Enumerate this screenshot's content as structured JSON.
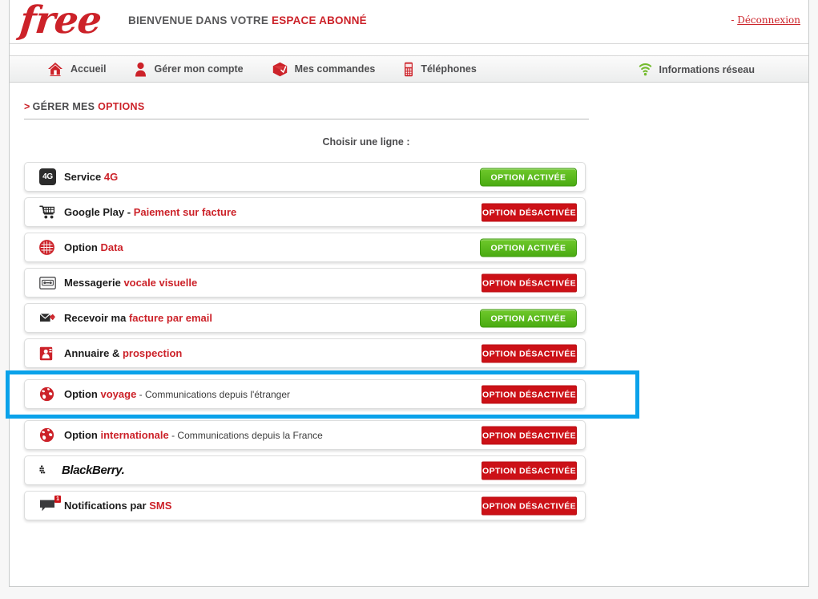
{
  "header": {
    "logo": "free",
    "welcome_prefix": "BIENVENUE DANS VOTRE ",
    "welcome_highlight": "ESPACE ABONNÉ",
    "logout_dash": "- ",
    "logout_label": "Déconnexion"
  },
  "nav": {
    "items": [
      {
        "label": "Accueil",
        "icon": "home-icon"
      },
      {
        "label": "Gérer mon compte",
        "icon": "person-icon"
      },
      {
        "label": "Mes commandes",
        "icon": "package-icon"
      },
      {
        "label": "Téléphones",
        "icon": "mobile-phone-icon"
      }
    ],
    "right": {
      "label": "Informations réseau",
      "icon": "wifi-icon"
    }
  },
  "breadcrumb": {
    "arrow": ">",
    "prefix": "GÉRER MES ",
    "highlight": "OPTIONS"
  },
  "main": {
    "choose_line_label": "Choisir une ligne :",
    "status_on_label": "OPTION ACTIVÉE",
    "status_off_label": "OPTION DÉSACTIVÉE"
  },
  "colors": {
    "brand_red": "#cc2229",
    "button_red": "#cc1117",
    "button_green": "#5bbd1e",
    "selection_blue": "#0aa2ea",
    "wifi_green": "#74bb2e"
  },
  "options": [
    {
      "icon": "4g-icon",
      "label_bold": "Service ",
      "label_red": "4G",
      "label_sub": "",
      "status": "on",
      "selected": false
    },
    {
      "icon": "shopping-cart-icon",
      "label_bold": "Google Play - ",
      "label_red": "Paiement sur facture",
      "label_sub": "",
      "status": "off",
      "selected": false
    },
    {
      "icon": "globe-grid-icon",
      "label_bold": "Option ",
      "label_red": "Data",
      "label_sub": "",
      "status": "on",
      "selected": false
    },
    {
      "icon": "cassette-tape-icon",
      "label_bold": "Messagerie ",
      "label_red": "vocale visuelle",
      "label_sub": "",
      "status": "off",
      "selected": false
    },
    {
      "icon": "envelope-icon",
      "label_bold": "Recevoir ma ",
      "label_red": "facture par email",
      "label_sub": "",
      "status": "on",
      "selected": false
    },
    {
      "icon": "directory-book-icon",
      "label_bold": "Annuaire & ",
      "label_red": "prospection",
      "label_sub": "",
      "status": "off",
      "selected": false
    },
    {
      "icon": "globe-world-icon",
      "label_bold": "Option ",
      "label_red": "voyage",
      "label_sub": " - Communications depuis l'étranger",
      "status": "off",
      "selected": true
    },
    {
      "icon": "globe-world-icon",
      "label_bold": "Option ",
      "label_red": "internationale",
      "label_sub": " - Communications depuis la France",
      "status": "off",
      "selected": false
    },
    {
      "icon": "blackberry-logo-icon",
      "label_bold": "",
      "label_red": "",
      "label_sub": "",
      "brand_text": "BlackBerry.",
      "status": "off",
      "selected": false
    },
    {
      "icon": "speech-bubble-icon",
      "badge": "1",
      "label_bold": "Notifications par ",
      "label_red": "SMS",
      "label_sub": "",
      "status": "off",
      "selected": false
    }
  ]
}
